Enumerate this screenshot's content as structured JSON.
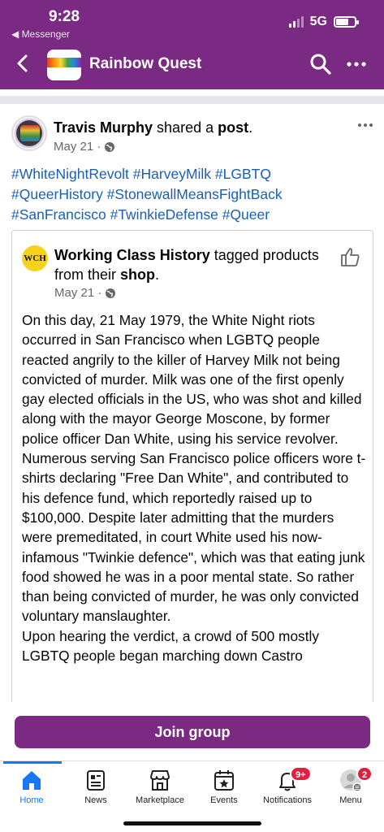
{
  "status_bar": {
    "time": "9:28",
    "back_app": "◀ Messenger",
    "network": "5G"
  },
  "header": {
    "title": "Rainbow Quest",
    "icons": [
      "chevron-left-icon",
      "search-icon",
      "more-icon"
    ]
  },
  "post": {
    "author": "Travis Murphy",
    "action_prefix": " shared a ",
    "action_object": "post",
    "action_suffix": ".",
    "date": "May 21 ·",
    "hashtags_line1": "#WhiteNightRevolt #HarveyMilk #LGBTQ",
    "hashtags_line2": "#QueerHistory #StonewallMeansFightBack",
    "hashtags_line3": "#SanFrancisco #TwinkieDefense #Queer"
  },
  "shared": {
    "logo_text": "WCH",
    "author": "Working Class History",
    "action_text": " tagged products from their ",
    "action_bold": "shop",
    "action_suffix": ".",
    "date": "May 21 ·",
    "paragraph1": "On this day, 21 May 1979, the White Night riots occurred in San Francisco when LGBTQ people reacted angrily to the killer of Harvey Milk not being convicted of murder. Milk was one of the first openly gay elected officials in the US, who was shot and killed along with the mayor George Moscone, by former police officer Dan White, using his service revolver.",
    "paragraph2": "Numerous serving San Francisco police officers wore t-shirts declaring \"Free Dan White\", and contributed to his defence fund, which reportedly raised up to $100,000.  Despite later admitting that the murders were premeditated, in court White used his now-infamous \"Twinkie defence\", which was that eating junk food showed he was in a poor mental state. So rather than being convicted of murder, he was only convicted voluntary manslaughter.",
    "paragraph3": "Upon hearing the verdict, a crowd of 500 mostly LGBTQ people began marching down Castro"
  },
  "join_button": "Join group",
  "tabs": [
    {
      "label": "Home",
      "icon": "home-icon",
      "active": true
    },
    {
      "label": "News",
      "icon": "news-icon"
    },
    {
      "label": "Marketplace",
      "icon": "marketplace-icon"
    },
    {
      "label": "Events",
      "icon": "events-icon"
    },
    {
      "label": "Notifications",
      "icon": "bell-icon",
      "badge": "9+"
    },
    {
      "label": "Menu",
      "icon": "menu-avatar-icon",
      "badge": "2"
    }
  ],
  "colors": {
    "brand_purple": "#7b2a83",
    "link_blue": "#1a5fb4",
    "active_tab": "#1877f2",
    "badge_red": "#e41e3f"
  }
}
